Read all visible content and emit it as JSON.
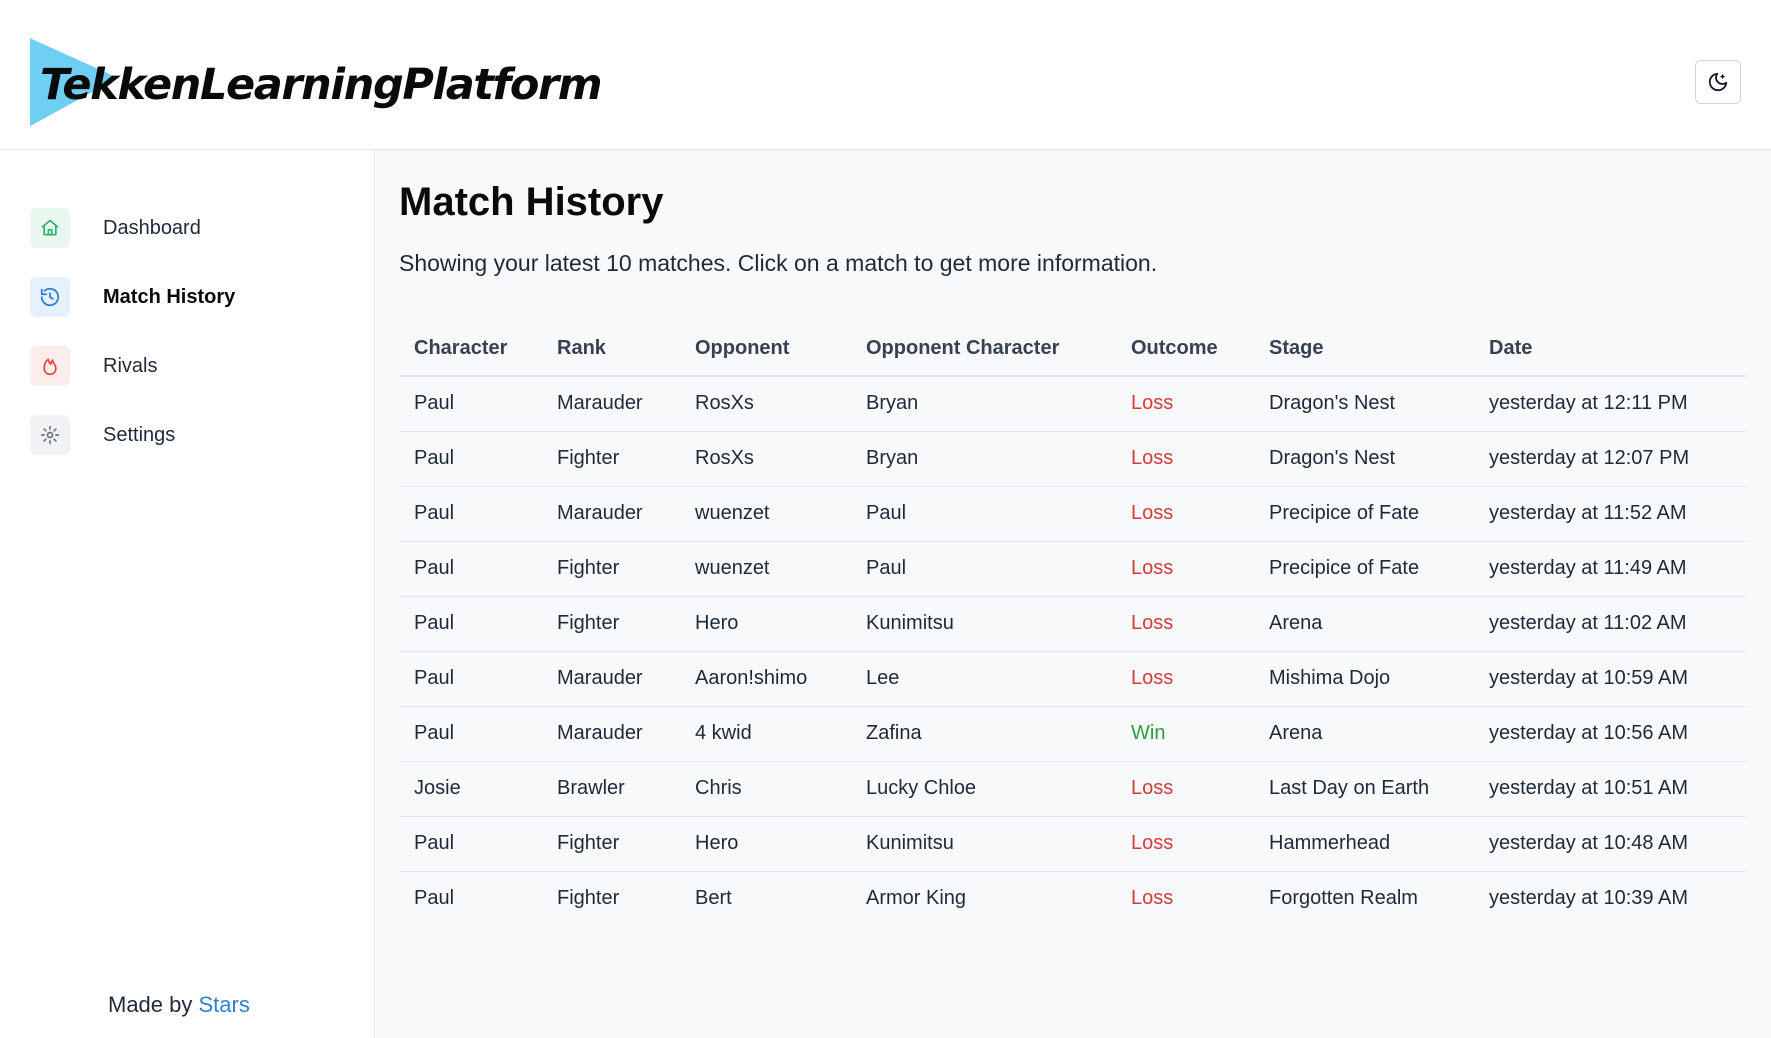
{
  "app": {
    "logo_text": "TekkenLearningPlatform",
    "logo_color": "#6fcff2"
  },
  "header": {
    "theme_toggle_icon": "moon-icon"
  },
  "sidebar": {
    "items": [
      {
        "label": "Dashboard",
        "icon": "home-icon",
        "active": false,
        "bg": "#e8f7ef",
        "color": "#2fb06a"
      },
      {
        "label": "Match History",
        "icon": "history-icon",
        "active": true,
        "bg": "#e7f1fb",
        "color": "#2f7fd6"
      },
      {
        "label": "Rivals",
        "icon": "flame-icon",
        "active": false,
        "bg": "#fdecec",
        "color": "#e0443c"
      },
      {
        "label": "Settings",
        "icon": "gear-icon",
        "active": false,
        "bg": "#f1f2f4",
        "color": "#6b7280"
      }
    ],
    "footer_prefix": "Made by ",
    "footer_author": "Stars"
  },
  "main": {
    "title": "Match History",
    "subtitle": "Showing your latest 10 matches. Click on a match to get more information.",
    "columns": [
      "Character",
      "Rank",
      "Opponent",
      "Opponent Character",
      "Outcome",
      "Stage",
      "Date"
    ],
    "rows": [
      [
        "Paul",
        "Marauder",
        "RosXs",
        "Bryan",
        "Loss",
        "Dragon's Nest",
        "yesterday at 12:11 PM"
      ],
      [
        "Paul",
        "Fighter",
        "RosXs",
        "Bryan",
        "Loss",
        "Dragon's Nest",
        "yesterday at 12:07 PM"
      ],
      [
        "Paul",
        "Marauder",
        "wuenzet",
        "Paul",
        "Loss",
        "Precipice of Fate",
        "yesterday at 11:52 AM"
      ],
      [
        "Paul",
        "Fighter",
        "wuenzet",
        "Paul",
        "Loss",
        "Precipice of Fate",
        "yesterday at 11:49 AM"
      ],
      [
        "Paul",
        "Fighter",
        "Hero",
        "Kunimitsu",
        "Loss",
        "Arena",
        "yesterday at 11:02 AM"
      ],
      [
        "Paul",
        "Marauder",
        "Aaron!shimo",
        "Lee",
        "Loss",
        "Mishima Dojo",
        "yesterday at 10:59 AM"
      ],
      [
        "Paul",
        "Marauder",
        "4 kwid",
        "Zafina",
        "Win",
        "Arena",
        "yesterday at 10:56 AM"
      ],
      [
        "Josie",
        "Brawler",
        "Chris",
        "Lucky Chloe",
        "Loss",
        "Last Day on Earth",
        "yesterday at 10:51 AM"
      ],
      [
        "Paul",
        "Fighter",
        "Hero",
        "Kunimitsu",
        "Loss",
        "Hammerhead",
        "yesterday at 10:48 AM"
      ],
      [
        "Paul",
        "Fighter",
        "Bert",
        "Armor King",
        "Loss",
        "Forgotten Realm",
        "yesterday at 10:39 AM"
      ]
    ]
  },
  "colors": {
    "loss": "#d33a3a",
    "win": "#2e9b3e",
    "link": "#2f7fd6"
  }
}
